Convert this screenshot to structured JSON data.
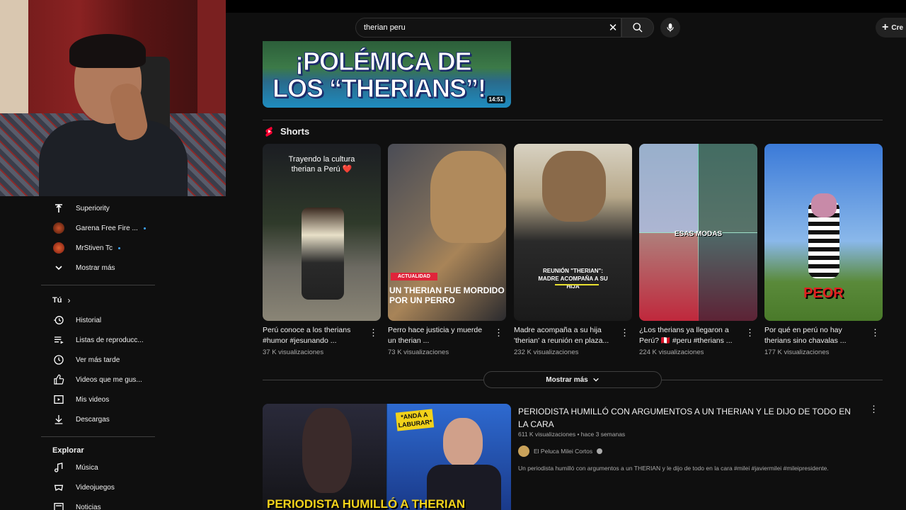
{
  "search": {
    "query": "therian peru"
  },
  "header": {
    "create_label": "Cre"
  },
  "sidebar": {
    "subscriptions": [
      {
        "label": "Superiority",
        "icon": "t-logo-icon"
      },
      {
        "label": "Garena Free Fire ...",
        "icon": "avatar",
        "live": true
      },
      {
        "label": "MrStiven Tc",
        "icon": "avatar",
        "live": true
      },
      {
        "label": "Mostrar más",
        "icon": "chevron-down-icon"
      }
    ],
    "you_title": "Tú",
    "you_items": [
      {
        "label": "Historial",
        "icon": "history-icon"
      },
      {
        "label": "Listas de reproducc...",
        "icon": "playlist-icon"
      },
      {
        "label": "Ver más tarde",
        "icon": "clock-icon"
      },
      {
        "label": "Videos que me gus...",
        "icon": "thumb-up-icon"
      },
      {
        "label": "Mis videos",
        "icon": "my-videos-icon"
      },
      {
        "label": "Descargas",
        "icon": "download-icon"
      }
    ],
    "explore_title": "Explorar",
    "explore_items": [
      {
        "label": "Música",
        "icon": "music-icon"
      },
      {
        "label": "Videojuegos",
        "icon": "gaming-icon"
      },
      {
        "label": "Noticias",
        "icon": "news-icon"
      }
    ]
  },
  "top_video": {
    "thumb_line1": "¡POLÉMICA DE",
    "thumb_line2": "LOS “THERIANS”!",
    "duration": "14:51"
  },
  "shorts": {
    "title": "Shorts",
    "items": [
      {
        "title": "Perú conoce a los therians #humor #jesunando ...",
        "views": "37 K visualizaciones",
        "overlay": "Trayendo la cultura therian a Perú ❤️"
      },
      {
        "title": "Perro hace justicia y muerde un therian ...",
        "views": "73 K visualizaciones",
        "badge": "ACTUALIDAD",
        "overlay": "UN THERIAN FUE MORDIDO POR UN PERRO"
      },
      {
        "title": "Madre acompaña a su hija 'therian' a reunión en plaza...",
        "views": "232 K visualizaciones",
        "overlay": "REUNIÓN \"THERIAN\": MADRE ACOMPAÑA A SU HIJA"
      },
      {
        "title": "¿Los therians ya llegaron a Perú? 🇵🇪 #peru #therians ...",
        "views": "224 K visualizaciones",
        "overlay": "ESAS MODAS"
      },
      {
        "title": "Por qué en perú no hay therians sino chavalas ...",
        "views": "177 K visualizaciones",
        "overlay": "PEOR"
      }
    ],
    "show_more_label": "Mostrar más"
  },
  "video": {
    "title": "PERIODISTA HUMILLÓ CON ARGUMENTOS A UN THERIAN Y LE DIJO DE TODO EN LA CARA",
    "meta": "611 K visualizaciones • hace 3 semanas",
    "channel": "El Peluca Milei Cortos",
    "description": "Un periodista humilló con argumentos a un THERIAN y le dijo de todo en la cara #milei #javiermilei #mileipresidente.",
    "thumb_tag": "*ANDÁ A LABURAR*",
    "thumb_caption": "PERIODISTA HUMILLÓ A THERIAN"
  }
}
